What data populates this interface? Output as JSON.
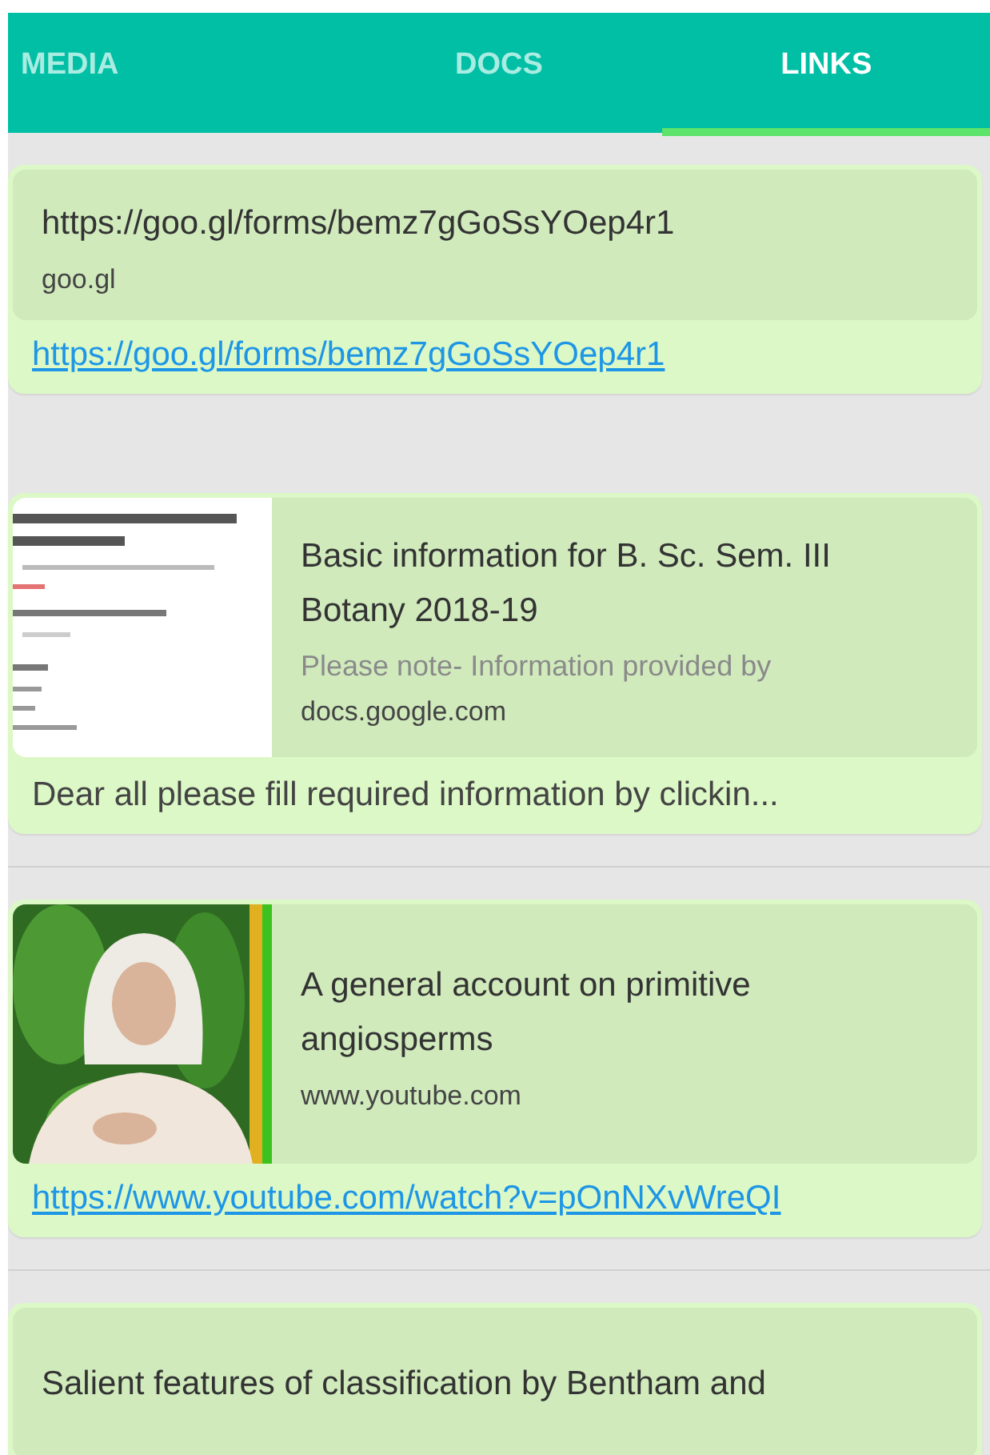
{
  "tabs": [
    {
      "label": "MEDIA",
      "selected": false
    },
    {
      "label": "DOCS",
      "selected": false
    },
    {
      "label": "LINKS",
      "selected": true
    }
  ],
  "messages": [
    {
      "preview": {
        "title": "https://goo.gl/forms/bemz7gGoSsYOep4r1",
        "domain": "goo.gl"
      },
      "body": {
        "kind": "link",
        "text": "https://goo.gl/forms/bemz7gGoSsYOep4r1"
      },
      "divider": false
    },
    {
      "preview": {
        "title": "Basic information for B. Sc. Sem. III Botany 2018-19",
        "description": "Please note- Information provided by",
        "domain": "docs.google.com"
      },
      "body": {
        "kind": "text",
        "text": "Dear all please fill required information by clickin..."
      },
      "divider": true
    },
    {
      "preview": {
        "title": "A general account on primitive angiosperms",
        "domain": "www.youtube.com"
      },
      "body": {
        "kind": "link",
        "text": "https://www.youtube.com/watch?v=pOnNXvWreQI"
      },
      "divider": true
    },
    {
      "preview": {
        "title": "Salient features of classification by Bentham and"
      }
    }
  ]
}
